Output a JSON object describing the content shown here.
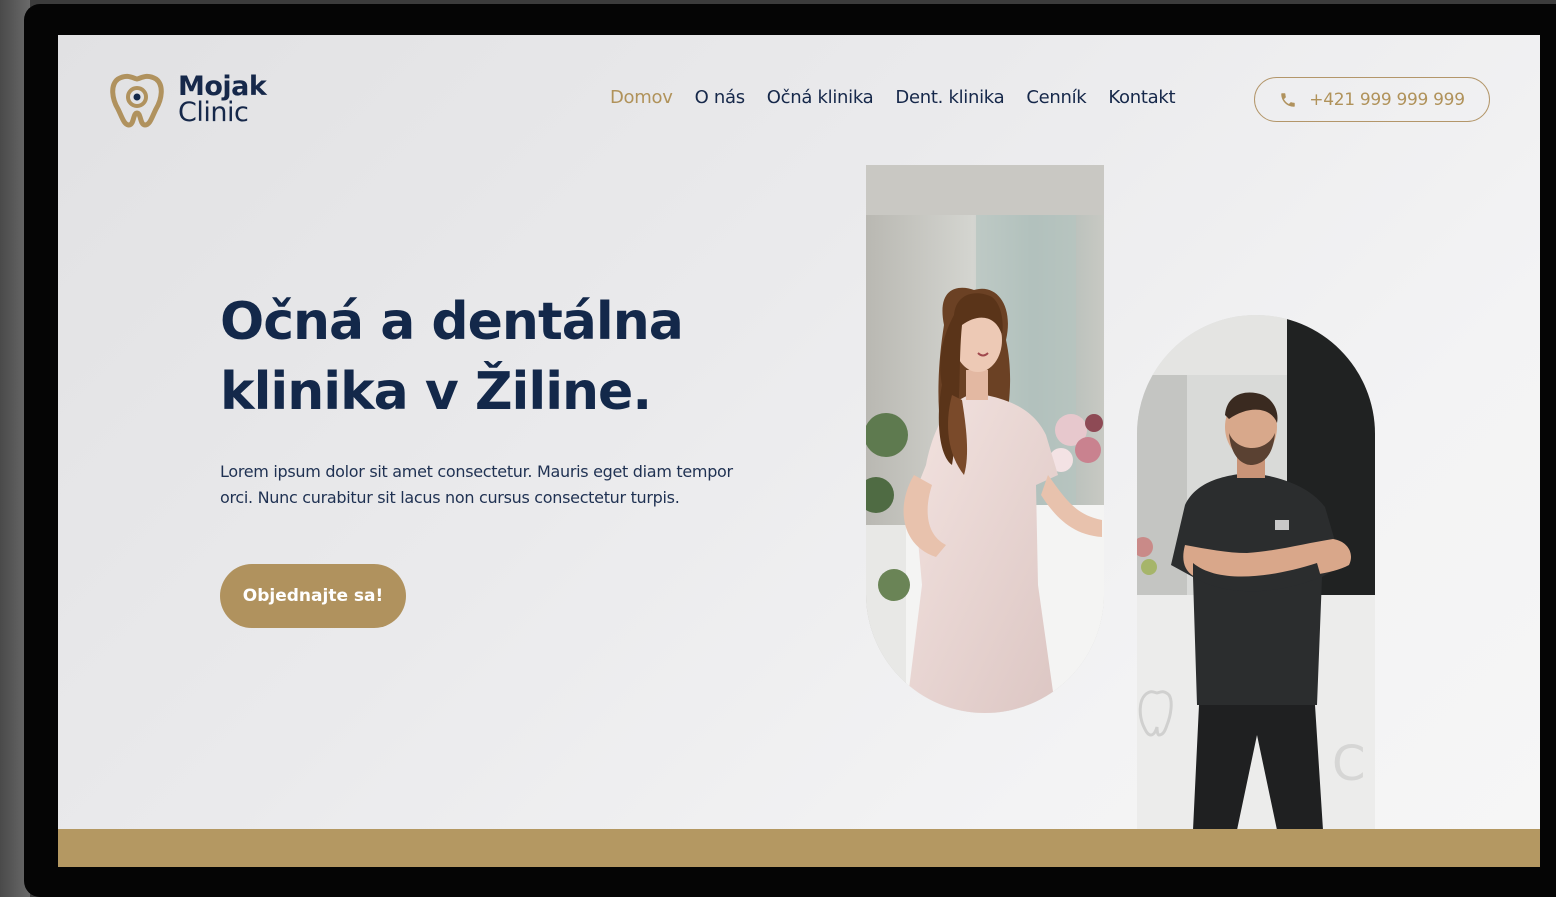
{
  "brand": {
    "name_line1": "Mojak",
    "name_line2": "Clinic",
    "logo_icon": "tooth-eye-logo-icon"
  },
  "nav": {
    "items": [
      {
        "label": "Domov",
        "active": true
      },
      {
        "label": "O nás",
        "active": false
      },
      {
        "label": "Očná klinika",
        "active": false
      },
      {
        "label": "Dent. klinika",
        "active": false
      },
      {
        "label": "Cenník",
        "active": false
      },
      {
        "label": "Kontakt",
        "active": false
      }
    ]
  },
  "header": {
    "phone": "+421 999 999 999",
    "phone_icon": "phone-icon"
  },
  "hero": {
    "title_line1": "Očná a dentálna",
    "title_line2": "klinika v Žiline.",
    "text": "Lorem ipsum dolor sit amet consectetur. Mauris eget diam tempor orci. Nunc curabitur sit lacus non cursus consectetur turpis.",
    "cta_label": "Objednajte sa!"
  },
  "colors": {
    "gold": "#b0925e",
    "navy": "#13284a",
    "background": "#ececed"
  }
}
